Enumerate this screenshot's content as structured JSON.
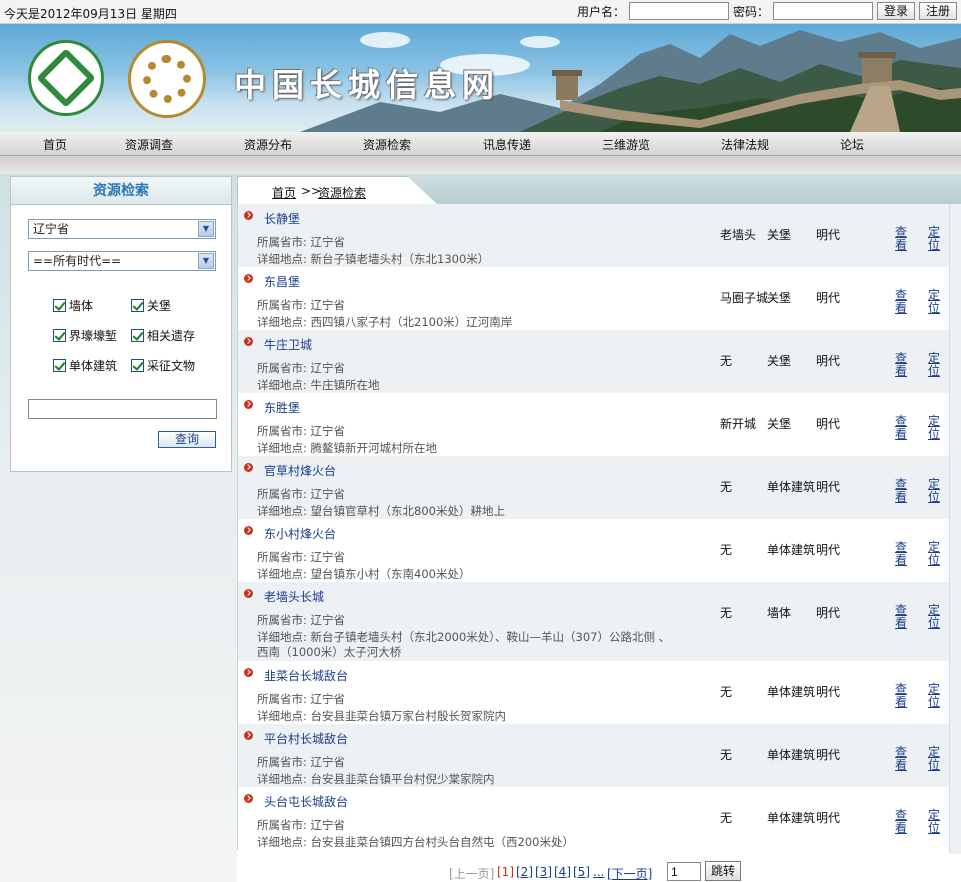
{
  "topbar": {
    "date_text": "今天是2012年09月13日 星期四",
    "username_label": "用户名：",
    "password_label": "密码：",
    "login_label": "登录",
    "register_label": "注册"
  },
  "banner": {
    "site_title": "中国长城信息网"
  },
  "nav": {
    "items": [
      "首页",
      "资源调查",
      "资源分布",
      "资源检索",
      "讯息传递",
      "三维游览",
      "法律法规",
      "论坛"
    ]
  },
  "search_panel": {
    "title": "资源检索",
    "province_selected": "辽宁省",
    "era_selected": "==所有时代==",
    "checkboxes": [
      "墙体",
      "关堡",
      "界壕壕堑",
      "相关遗存",
      "单体建筑",
      "采征文物"
    ],
    "keyword_value": "",
    "query_label": "查询"
  },
  "breadcrumb": {
    "home": "首页",
    "sep": ">>",
    "current": "资源检索"
  },
  "list": {
    "prov_prefix": "所属省市: ",
    "addr_prefix": "详细地点: ",
    "view_label": "查看",
    "locate_label": "定位",
    "rows": [
      {
        "name": "长静堡",
        "province": "辽宁省",
        "address": "新台子镇老墙头村（东北1300米）",
        "c1": "老墙头",
        "c2": "关堡",
        "c3": "明代"
      },
      {
        "name": "东昌堡",
        "province": "辽宁省",
        "address": "西四镇八家子村（北2100米）辽河南岸",
        "c1": "马圈子城",
        "c2": "关堡",
        "c3": "明代"
      },
      {
        "name": "牛庄卫城",
        "province": "辽宁省",
        "address": "牛庄镇所在地",
        "c1": "无",
        "c2": "关堡",
        "c3": "明代"
      },
      {
        "name": "东胜堡",
        "province": "辽宁省",
        "address": "腾鳌镇新开河城村所在地",
        "c1": "新开城",
        "c2": "关堡",
        "c3": "明代"
      },
      {
        "name": "官草村烽火台",
        "province": "辽宁省",
        "address": "望台镇官草村（东北800米处）耕地上",
        "c1": "无",
        "c2": "单体建筑",
        "c3": "明代"
      },
      {
        "name": "东小村烽火台",
        "province": "辽宁省",
        "address": "望台镇东小村（东南400米处）",
        "c1": "无",
        "c2": "单体建筑",
        "c3": "明代"
      },
      {
        "name": "老墙头长城",
        "province": "辽宁省",
        "address": "新台子镇老墙头村（东北2000米处）、鞍山—羊山（307）公路北侧 、西南（1000米）太子河大桥",
        "c1": "无",
        "c2": "墙体",
        "c3": "明代"
      },
      {
        "name": "韭菜台长城敌台",
        "province": "辽宁省",
        "address": "台安县韭菜台镇万家台村殷长贺家院内",
        "c1": "无",
        "c2": "单体建筑",
        "c3": "明代"
      },
      {
        "name": "平台村长城敌台",
        "province": "辽宁省",
        "address": "台安县韭菜台镇平台村倪少棠家院内",
        "c1": "无",
        "c2": "单体建筑",
        "c3": "明代"
      },
      {
        "name": "头台屯长城敌台",
        "province": "辽宁省",
        "address": "台安县韭菜台镇四方台村头台自然屯（西200米处）",
        "c1": "无",
        "c2": "单体建筑",
        "c3": "明代"
      }
    ]
  },
  "pager": {
    "prev": "[上一页]",
    "pages": [
      "[1]",
      "[2]",
      "[3]",
      "[4]",
      "[5]"
    ],
    "ellipsis": "...",
    "next": "[下一页]",
    "jump_value": "1",
    "go_label": "跳转"
  },
  "colors": {
    "link": "#1a3d8f",
    "accent_red": "#c8311c",
    "panel_title": "#2b79b8"
  }
}
